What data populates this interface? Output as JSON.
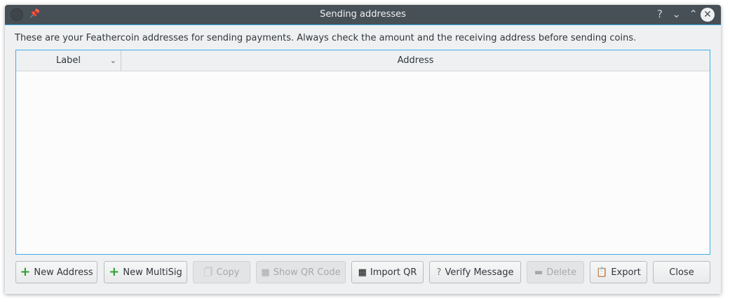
{
  "window": {
    "title": "Sending addresses",
    "help": "?",
    "minimize": "⌄",
    "maximize": "⌃",
    "close": "✕"
  },
  "description": "These are your Feathercoin addresses for sending payments. Always check the amount and the receiving address before sending coins.",
  "table": {
    "columns": [
      "Label",
      "Address"
    ],
    "rows": []
  },
  "buttons": {
    "new_address": "New Address",
    "new_multisig": "New MultiSig",
    "copy": "Copy",
    "show_qr": "Show QR Code",
    "import_qr": "Import QR",
    "verify": "Verify Message",
    "delete": "Delete",
    "export": "Export",
    "close": "Close"
  }
}
